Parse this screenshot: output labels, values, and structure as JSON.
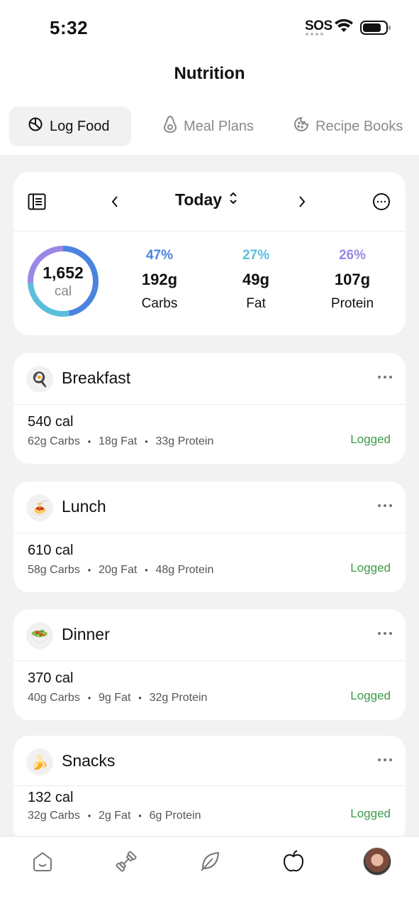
{
  "status_bar": {
    "time": "5:32",
    "sos": "SOS"
  },
  "header": {
    "title": "Nutrition"
  },
  "tabs": [
    {
      "label": "Log Food",
      "icon": "pie-chart-icon",
      "active": true
    },
    {
      "label": "Meal Plans",
      "icon": "avocado-icon",
      "active": false
    },
    {
      "label": "Recipe Books",
      "icon": "cookie-icon",
      "active": false
    }
  ],
  "summary": {
    "day": "Today",
    "calories": "1,652",
    "calories_unit": "cal",
    "ring_share": {
      "carbs": 0.47,
      "fat": 0.27,
      "protein": 0.26
    },
    "macros": [
      {
        "pct": "47%",
        "grams": "192g",
        "label": "Carbs",
        "color": "#4a84e0"
      },
      {
        "pct": "27%",
        "grams": "49g",
        "label": "Fat",
        "color": "#5bbfdc"
      },
      {
        "pct": "26%",
        "grams": "107g",
        "label": "Protein",
        "color": "#9b87e6"
      }
    ]
  },
  "meals": [
    {
      "name": "Breakfast",
      "emoji": "🍳",
      "calories": "540 cal",
      "carbs": "62g Carbs",
      "fat": "18g Fat",
      "protein": "33g Protein",
      "status": "Logged"
    },
    {
      "name": "Lunch",
      "emoji": "🍝",
      "calories": "610 cal",
      "carbs": "58g Carbs",
      "fat": "20g Fat",
      "protein": "48g Protein",
      "status": "Logged"
    },
    {
      "name": "Dinner",
      "emoji": "🥗",
      "calories": "370 cal",
      "carbs": "40g Carbs",
      "fat": "9g Fat",
      "protein": "32g Protein",
      "status": "Logged"
    },
    {
      "name": "Snacks",
      "emoji": "🍌",
      "calories": "132 cal",
      "carbs": "32g Carbs",
      "fat": "2g Fat",
      "protein": "6g Protein",
      "status": "Logged"
    }
  ],
  "colors": {
    "logged": "#3c9a4a",
    "background": "#f2f2f2"
  },
  "bottom_nav": [
    {
      "icon": "home-icon"
    },
    {
      "icon": "dumbbell-icon"
    },
    {
      "icon": "leaf-icon"
    },
    {
      "icon": "apple-icon",
      "active": true
    },
    {
      "icon": "profile-avatar"
    }
  ]
}
